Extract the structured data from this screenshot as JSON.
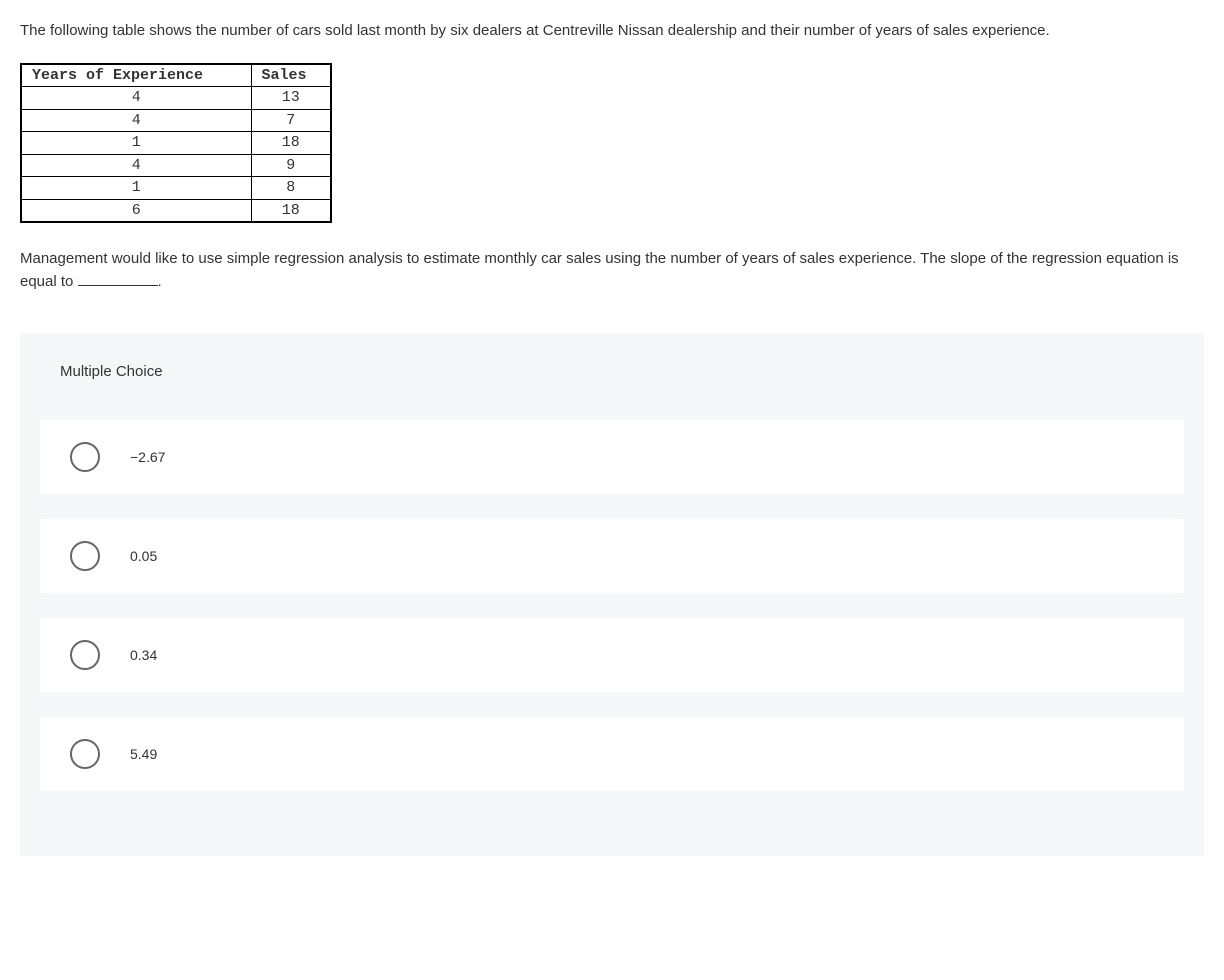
{
  "question": {
    "intro": "The following table shows the number of cars sold last month by six dealers at Centreville Nissan dealership and their number of years of sales experience.",
    "prompt_before": "Management would like to use simple regression analysis to estimate monthly car sales using the number of years of sales experience. The slope of the regression equation is equal to ",
    "prompt_after": "."
  },
  "table": {
    "headers": [
      "Years of Experience",
      "Sales"
    ],
    "rows": [
      [
        "4",
        "13"
      ],
      [
        "4",
        "7"
      ],
      [
        "1",
        "18"
      ],
      [
        "4",
        "9"
      ],
      [
        "1",
        "8"
      ],
      [
        "6",
        "18"
      ]
    ]
  },
  "mc": {
    "title": "Multiple Choice",
    "options": [
      "−2.67",
      "0.05",
      "0.34",
      "5.49"
    ]
  }
}
